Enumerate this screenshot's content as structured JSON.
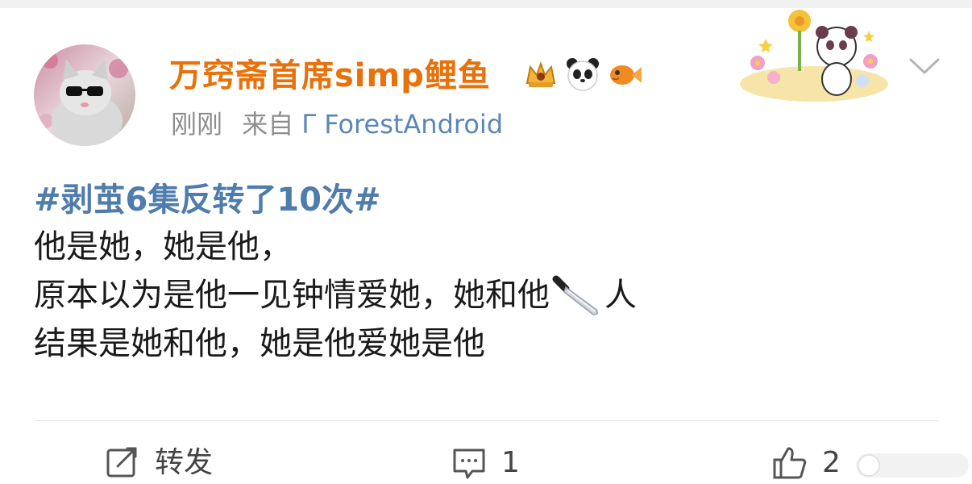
{
  "post": {
    "author": {
      "name": "万窍斋首席simp鲤鱼"
    },
    "badges": [
      "crown-badge-icon",
      "panda-badge-icon",
      "goldfish-badge-icon"
    ],
    "time": "刚刚",
    "source_prefix": "来自",
    "source": "Γ ForestAndroid",
    "hashtag": "#剥茧6集反转了10次#",
    "lines": [
      "他是她，她是他，",
      "原本以为是他一见钟情爱她，她和他",
      "人",
      "结果是她和他，她是他爱她是他"
    ]
  },
  "actions": {
    "repost_label": "转发",
    "comment_count": "1",
    "like_count": "2"
  },
  "colors": {
    "author": "#e8710a",
    "hashtag": "#4e7cad",
    "source": "#5b86b6",
    "meta": "#8e8e8e",
    "text": "#1a1a1a"
  }
}
